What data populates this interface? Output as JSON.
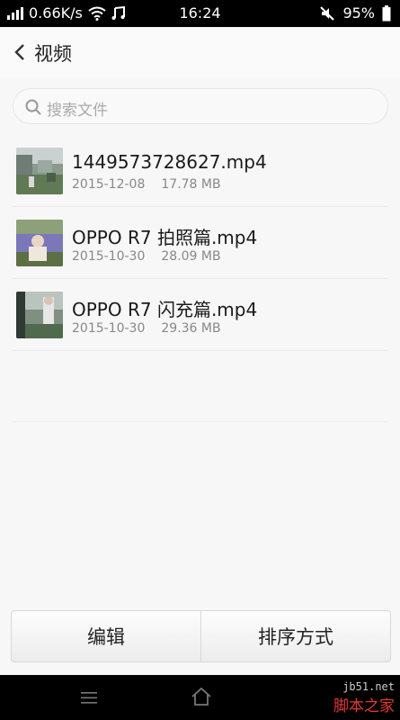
{
  "status_bar": {
    "speed": "0.66K/s",
    "time": "16:24",
    "battery": "95%",
    "icons": [
      "signal-icon",
      "wifi-icon",
      "music-icon",
      "mute-icon",
      "battery-icon"
    ]
  },
  "header": {
    "title": "视频"
  },
  "search": {
    "placeholder": "搜索文件"
  },
  "files": [
    {
      "name": "1449573728627.mp4",
      "date": "2015-12-08",
      "size": "17.78 MB"
    },
    {
      "name": "OPPO R7 拍照篇.mp4",
      "date": "2015-10-30",
      "size": "28.09 MB"
    },
    {
      "name": "OPPO R7 闪充篇.mp4",
      "date": "2015-10-30",
      "size": "29.36 MB"
    }
  ],
  "bottom_bar": {
    "edit_label": "编辑",
    "sort_label": "排序方式"
  },
  "watermark": {
    "line1": "jb51.net",
    "line2": "脚本之家"
  },
  "colors": {
    "status_bar_bg": "#000000",
    "page_bg": "#f7f7f7",
    "watermark_red": "#e53935"
  }
}
